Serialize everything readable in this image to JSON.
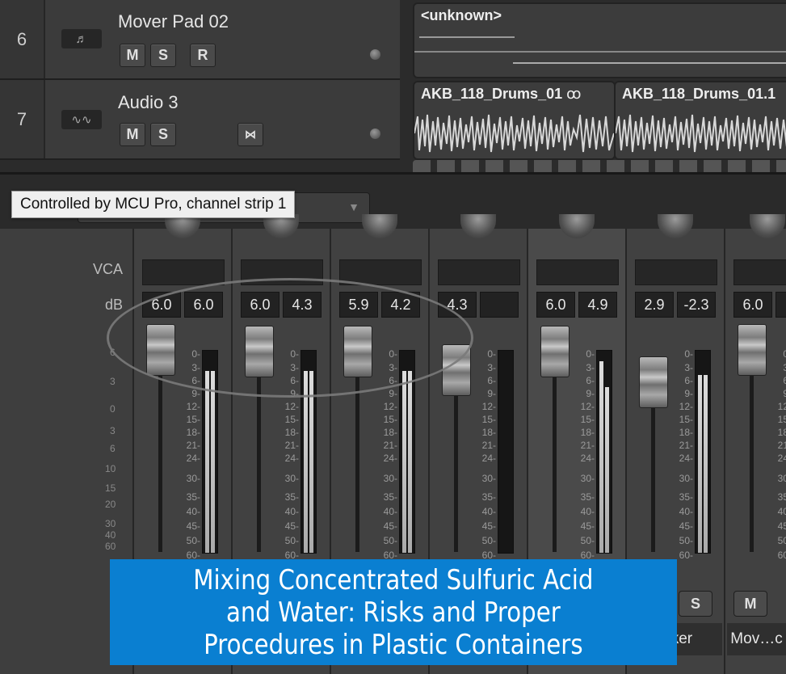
{
  "tracks": [
    {
      "num": "6",
      "name": "Mover Pad 02",
      "buttons": [
        "M",
        "S",
        "R"
      ],
      "region": "<unknown>"
    },
    {
      "num": "7",
      "name": "Audio 3",
      "buttons": [
        "M",
        "S"
      ],
      "regions": [
        "AKB_118_Drums_01",
        "AKB_118_Drums_01.1"
      ],
      "loop_glyph": "ꝏ"
    }
  ],
  "tooltip": "Controlled by MCU Pro, channel strip 1",
  "mixer": {
    "row_labels": {
      "vca": "VCA",
      "db": "dB"
    },
    "left_scale": [
      "6",
      "3",
      "0",
      "3",
      "6",
      "10",
      "15",
      "20",
      "30",
      "40",
      "60"
    ],
    "fader_scale": [
      "0",
      "3",
      "6",
      "9",
      "12",
      "15",
      "18",
      "21",
      "24",
      "30",
      "35",
      "40",
      "45",
      "50",
      "60"
    ],
    "strips": [
      {
        "vol": "6.0",
        "peak": "6.0",
        "meter_level": 0.9
      },
      {
        "vol": "6.0",
        "peak": "4.3",
        "meter_level": 0.9
      },
      {
        "vol": "5.9",
        "peak": "4.2",
        "meter_level": 0.9
      },
      {
        "vol": "4.3",
        "peak": "",
        "meter_level": 0.0
      },
      {
        "vol": "6.0",
        "peak": "4.9",
        "meter_level": 0.95
      },
      {
        "vol": "2.9",
        "peak": "-2.3",
        "meter_level": 0.88
      },
      {
        "vol": "6.0",
        "peak": "",
        "meter_level": 0.9
      }
    ],
    "bottom": {
      "s_label": "S",
      "m_label": "M",
      "name_1": ".eker",
      "name_2": "Mov…c"
    }
  },
  "banner": {
    "line1": "Mixing Concentrated Sulfuric Acid",
    "line2": "and Water: Risks and Proper",
    "line3": "Procedures in Plastic Containers"
  },
  "colors": {
    "banner": "#0a7fd1",
    "background": "#3c3c3c"
  }
}
